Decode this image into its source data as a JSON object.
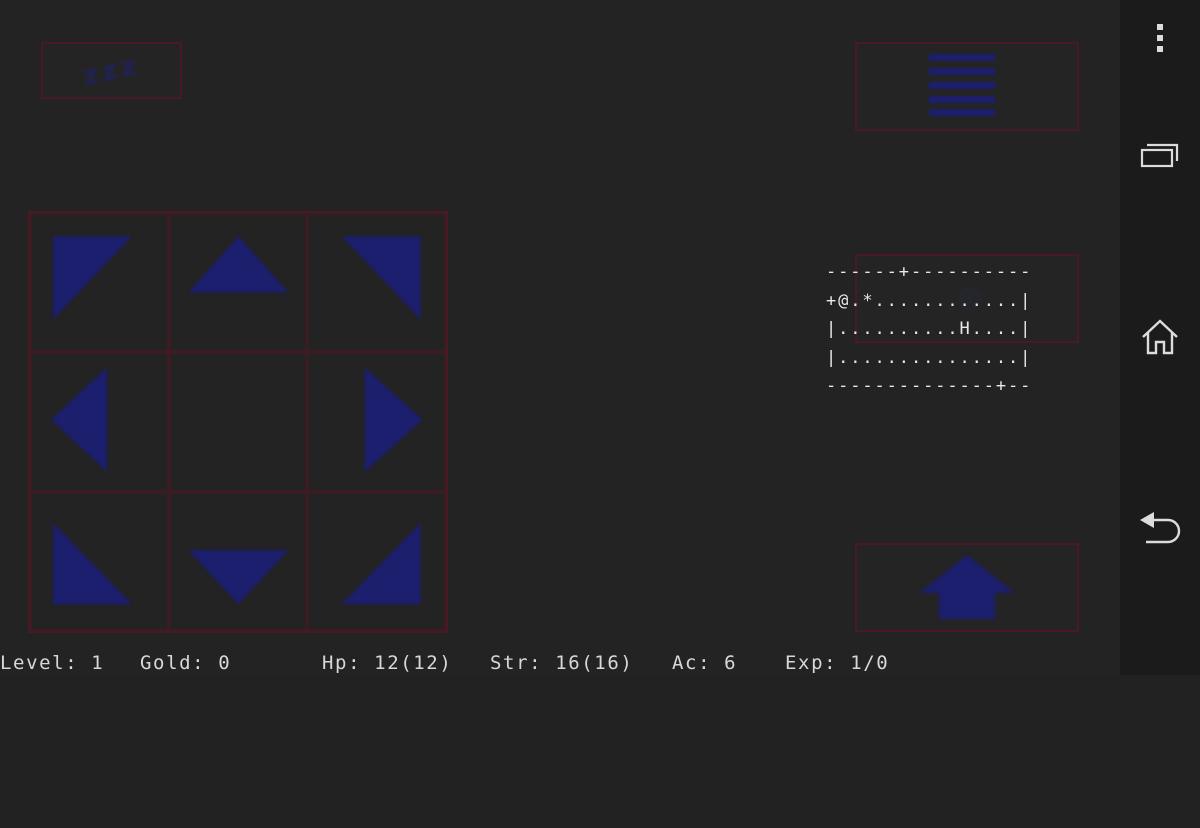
{
  "buttons": {
    "sleep": {
      "label": "zzz",
      "icon": "sleep-icon"
    },
    "menu": {
      "icon": "menu-icon"
    },
    "search": {
      "icon": "search-icon"
    },
    "stairs": {
      "icon": "up-arrow-icon"
    }
  },
  "dpad": [
    "up-left",
    "up",
    "up-right",
    "left",
    "rest",
    "right",
    "down-left",
    "down",
    "down-right"
  ],
  "map": {
    "rows": [
      "------+----------",
      "+@.*............|",
      "|..........H....|",
      "|...............|",
      "--------------+--"
    ]
  },
  "status": {
    "level": "Level: 1",
    "gold": "Gold: 0",
    "hp": "Hp: 12(12)",
    "str": "Str: 16(16)",
    "ac": "Ac: 6",
    "exp": "Exp: 1/0"
  },
  "navbar": {
    "icons": [
      "overflow-menu-icon",
      "recent-apps-icon",
      "home-icon",
      "back-icon"
    ]
  },
  "colors": {
    "arrow": "#1c1e6e",
    "border": "#4a1a24",
    "background": "#232323",
    "text": "#e8e8e8"
  }
}
